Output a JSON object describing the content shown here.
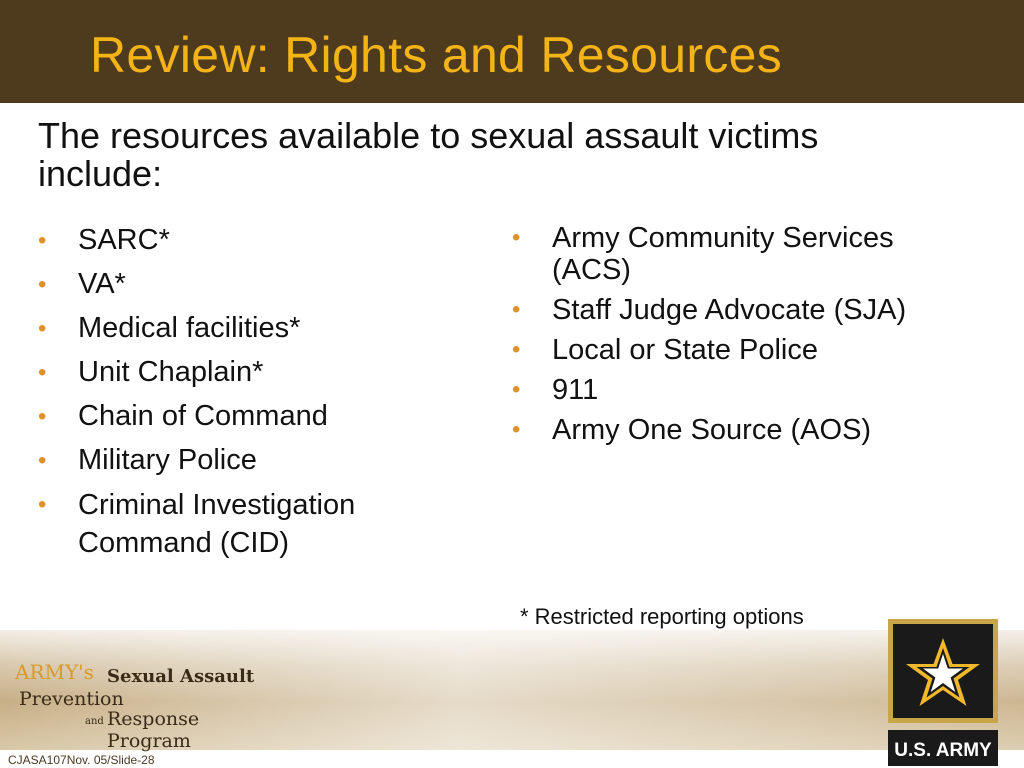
{
  "slide": {
    "title": "Review: Rights and Resources",
    "intro": "The resources available to sexual assault victims include:",
    "left_list": [
      "SARC*",
      "VA*",
      "Medical facilities*",
      "Unit Chaplain*",
      "Chain of Command",
      "Military Police",
      "Criminal Investigation Command (CID)"
    ],
    "right_list": [
      "Army Community Services (ACS)",
      "Staff Judge Advocate (SJA)",
      "Local or State Police",
      "911",
      "Army One Source (AOS)"
    ],
    "bullet": "•",
    "note": "* Restricted reporting options"
  },
  "footer": {
    "program_logo": {
      "line1_army": "ARMY's",
      "line1_rest": "Sexual Assault",
      "line2": "Prevention",
      "line3_and": "and",
      "line3_rest": "Response Program"
    },
    "army_logo_text": "U.S. ARMY",
    "slide_id": "CJASA107Nov. 05/Slide-28"
  },
  "colors": {
    "title_bar": "#4e3a1c",
    "title_text": "#f4b418",
    "bullet": "#e0922a"
  }
}
